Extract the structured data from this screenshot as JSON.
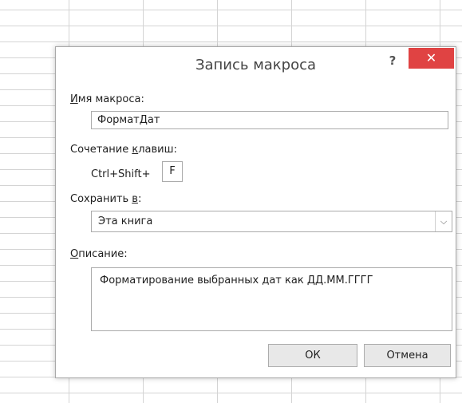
{
  "dialog": {
    "title": "Запись макроса",
    "help_label": "?",
    "close_label": "✕"
  },
  "macro_name": {
    "label_underlined": "И",
    "label_rest": "мя макроса:",
    "value": "ФорматДат"
  },
  "shortcut": {
    "label_before": "Сочетание ",
    "label_underlined": "к",
    "label_after": "лавиш:",
    "prefix": "Ctrl+Shift+",
    "key": "F"
  },
  "store_in": {
    "label_before": "Сохранить ",
    "label_underlined": "в",
    "label_after": ":",
    "selected": "Эта книга"
  },
  "description": {
    "label_underlined": "О",
    "label_rest": "писание:",
    "value": "Форматирование выбранных дат как ДД.ММ.ГГГГ"
  },
  "buttons": {
    "ok_label": "ОК",
    "cancel_label": "Отмена"
  },
  "colors": {
    "close_button": "#e04343",
    "border": "#ababab",
    "button_face": "#e8e8e8"
  }
}
